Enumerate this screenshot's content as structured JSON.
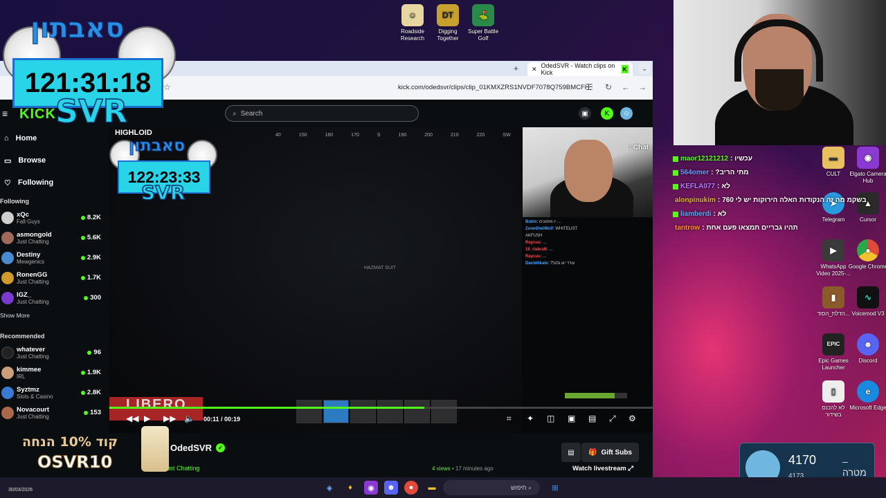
{
  "browser": {
    "tab_title": "OdedSVR - Watch clips on Kick",
    "url": "kick.com/odedsvr/clips/clip_01KMXZRS1NVDF7078Q759BMCFH"
  },
  "kick": {
    "logo": "KICK",
    "search_placeholder": "Search",
    "nav": [
      {
        "label": "Home",
        "icon": "⌂"
      },
      {
        "label": "Browse",
        "icon": "▭"
      },
      {
        "label": "Following",
        "icon": "♡"
      }
    ],
    "following_heading": "Following",
    "following": [
      {
        "name": "xQc",
        "category": "Fall Guys",
        "viewers": "8.2K",
        "color": "#cfcfcf"
      },
      {
        "name": "asmongold",
        "category": "Just Chatting",
        "viewers": "5.6K",
        "color": "#a06a5a"
      },
      {
        "name": "Destiny",
        "category": "Mewgenics",
        "viewers": "2.9K",
        "color": "#4a8ad0"
      },
      {
        "name": "RonenGG",
        "category": "Just Chatting",
        "viewers": "1.7K",
        "color": "#d09a2a"
      },
      {
        "name": "IGZ_",
        "category": "Just Chatting",
        "viewers": "300",
        "color": "#7a3ad0"
      }
    ],
    "show_more": "Show More",
    "recommended_heading": "Recommended",
    "recommended": [
      {
        "name": "whatever",
        "category": "Just Chatting",
        "viewers": "96",
        "color": "#222"
      },
      {
        "name": "kimmee",
        "category": "IRL",
        "viewers": "1.9K",
        "color": "#c9a07a"
      },
      {
        "name": "Syztmz",
        "category": "Slots & Casino",
        "viewers": "2.8K",
        "color": "#3a7ad0"
      },
      {
        "name": "Novacourt",
        "category": "Just Chatting",
        "viewers": "153",
        "color": "#aa6a4a"
      }
    ],
    "player": {
      "compass": [
        "40",
        "150",
        "160",
        "170",
        "S",
        "190",
        "200",
        "210",
        "220",
        "SW"
      ],
      "hazmat": "HAZMAT SUIT",
      "highlight": "HIGHLOID",
      "libero": "LIBERO",
      "chat_button": "Chat",
      "time_current": "00:11",
      "time_total": "00:19",
      "progress": 0.579,
      "hp": "73"
    },
    "game_chat": [
      {
        "user": "Bubix",
        "text": "יו מוזמנים ..."
      },
      {
        "user": "ZoneShelWolf",
        "text": "WHITELIST"
      },
      {
        "user": "",
        "text": "AKFUSH"
      },
      {
        "user": "Raycuu",
        "text": "..."
      },
      {
        "user": "19_rlabraN",
        "text": "..."
      },
      {
        "user": "Raycuu",
        "text": "..."
      },
      {
        "user": "DavidAkalo",
        "text": "?עודד יש גלגל"
      }
    ],
    "channel": {
      "name": "OdedSVR",
      "category": "Just Chatting",
      "views": "4 views",
      "posted": "17 minutes ago",
      "gift_subs": "Gift Subs",
      "watch_livestream": "Watch livestream"
    }
  },
  "overlays": {
    "timer_main": "121:31:18",
    "timer_inner": "122:23:33",
    "svr": "SVR",
    "heb_logo": "סאבתון",
    "promo_line1": "קוד 10% הנחה",
    "promo_line2": "OSVR10"
  },
  "overlay_chat": [
    {
      "user": "maor12121212",
      "text": "עכשיו"
    },
    {
      "user": "564omer",
      "text": "?מתי הריב"
    },
    {
      "user": "KEFLA077",
      "text": "לא"
    },
    {
      "user": "alonpinukim",
      "text": "760 בשקמ מה זה הנקודות האלה הירוקות יש לי"
    },
    {
      "user": "liamberdi",
      "text": "לא"
    },
    {
      "user": "tantrow",
      "text": "תהיו גבריים תמצאו פעם אחת"
    }
  ],
  "desktop_icons": [
    {
      "label": "Roadside Research",
      "glyph": "☺",
      "bg": "#e8d6a0"
    },
    {
      "label": "Digging Together",
      "glyph": "DT",
      "bg": "#c8a030"
    },
    {
      "label": "Super Battle Golf",
      "glyph": "⛳",
      "bg": "#2a8a4a"
    },
    {
      "label": "CULT",
      "glyph": "▬",
      "bg": "#e8c060"
    },
    {
      "label": "Elgato Camera Hub",
      "glyph": "◉",
      "bg": "#8a3ad0"
    },
    {
      "label": "Telegram",
      "glyph": "➤",
      "bg": "#2a9ae0"
    },
    {
      "label": "Cursor",
      "glyph": "▲",
      "bg": "#2a2a2a"
    },
    {
      "label": "WhatsApp Video 2025-...",
      "glyph": "▶",
      "bg": "#3a3a3a"
    },
    {
      "label": "Google Chrome",
      "glyph": "●",
      "bg": "#e04a3a"
    },
    {
      "label": "הדלת_הסוד...",
      "glyph": "▮",
      "bg": "#8a5a2a"
    },
    {
      "label": "Voicemod V3",
      "glyph": "∿",
      "bg": "#111"
    },
    {
      "label": "Epic Games Launcher",
      "glyph": "EPIC",
      "bg": "#222"
    },
    {
      "label": "Discord",
      "glyph": "☻",
      "bg": "#5865f2"
    },
    {
      "label": "לא להכנס בשידור",
      "glyph": "▯",
      "bg": "#eee"
    },
    {
      "label": "Microsoft Edge",
      "glyph": "e",
      "bg": "#1a8ae0"
    }
  ],
  "goal": {
    "value": "4170",
    "label": "מטרה",
    "target": "4173"
  },
  "taskbar": {
    "search": "חיפוש",
    "date": "30/03/2026"
  }
}
